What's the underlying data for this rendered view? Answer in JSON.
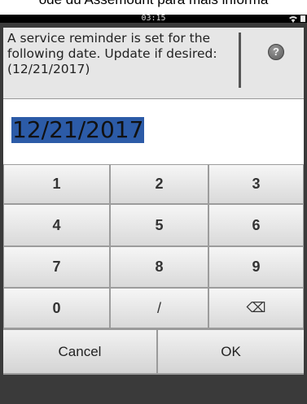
{
  "page_top_text": "ode du Assemount para mais informa",
  "status": {
    "time": "03:15"
  },
  "message": {
    "text": "A service reminder is set for the following date. Update if desired: (12/21/2017)"
  },
  "date_input": {
    "value": "12/21/2017"
  },
  "keypad": {
    "keys": [
      "1",
      "2",
      "3",
      "4",
      "5",
      "6",
      "7",
      "8",
      "9",
      "0",
      "/",
      "⌫"
    ]
  },
  "actions": {
    "cancel_label": "Cancel",
    "ok_label": "OK"
  },
  "colors": {
    "selection": "#2c5ba7",
    "frame": "#3a3a3a",
    "message_bg": "#e6e6e6"
  }
}
